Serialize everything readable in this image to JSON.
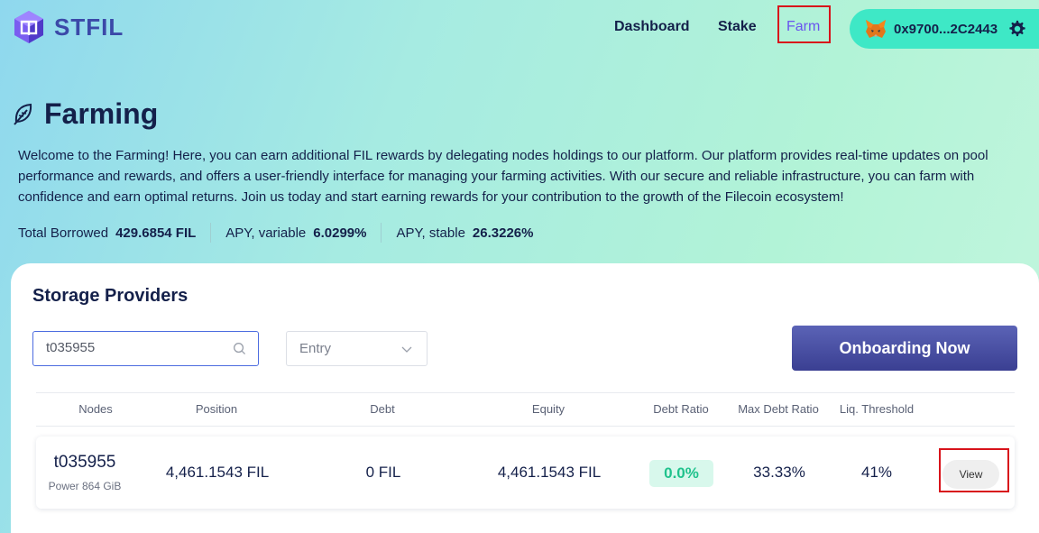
{
  "brand": {
    "name": "STFIL"
  },
  "nav": {
    "dashboard": "Dashboard",
    "stake": "Stake",
    "farm": "Farm"
  },
  "wallet": {
    "address": "0x9700...2C2443"
  },
  "page": {
    "title": "Farming",
    "intro": "Welcome to the Farming! Here, you can earn additional FIL rewards by delegating nodes holdings to our platform. Our platform provides real-time updates on pool performance and rewards, and offers a user-friendly interface for managing your farming activities. With our secure and reliable infrastructure, you can farm with confidence and earn optimal returns. Join us today and start earning rewards for your contribution to the growth of the Filecoin ecosystem!"
  },
  "stats": [
    {
      "label": "Total Borrowed",
      "value": "429.6854 FIL"
    },
    {
      "label": "APY, variable",
      "value": "6.0299%"
    },
    {
      "label": "APY, stable",
      "value": "26.3226%"
    }
  ],
  "providers": {
    "title": "Storage Providers",
    "search_value": "t035955",
    "entry_value": "Entry",
    "onboard_label": "Onboarding Now",
    "columns": [
      "Nodes",
      "Position",
      "Debt",
      "Equity",
      "Debt Ratio",
      "Max Debt Ratio",
      "Liq. Threshold"
    ],
    "rows": [
      {
        "node": "t035955",
        "power": "Power 864 GiB",
        "position": "4,461.1543 FIL",
        "debt": "0 FIL",
        "equity": "4,461.1543 FIL",
        "debt_ratio": "0.0%",
        "max_debt_ratio": "33.33%",
        "liq_threshold": "41%",
        "action": "View"
      }
    ]
  },
  "colors": {
    "brand": "#3b49a8",
    "nav_active": "#6a55ee",
    "wallet_bg": "#3ee8c6",
    "button_bg": "#3a3f92",
    "ratio_badge_text": "#1fc28c",
    "highlight_box": "#d8131b"
  },
  "icons": {
    "logo": "stfil-cube-logo",
    "wallet": "metamask-fox-icon",
    "settings": "gear-icon",
    "title": "leaf-icon",
    "search": "search-icon",
    "select": "chevron-down-icon"
  }
}
